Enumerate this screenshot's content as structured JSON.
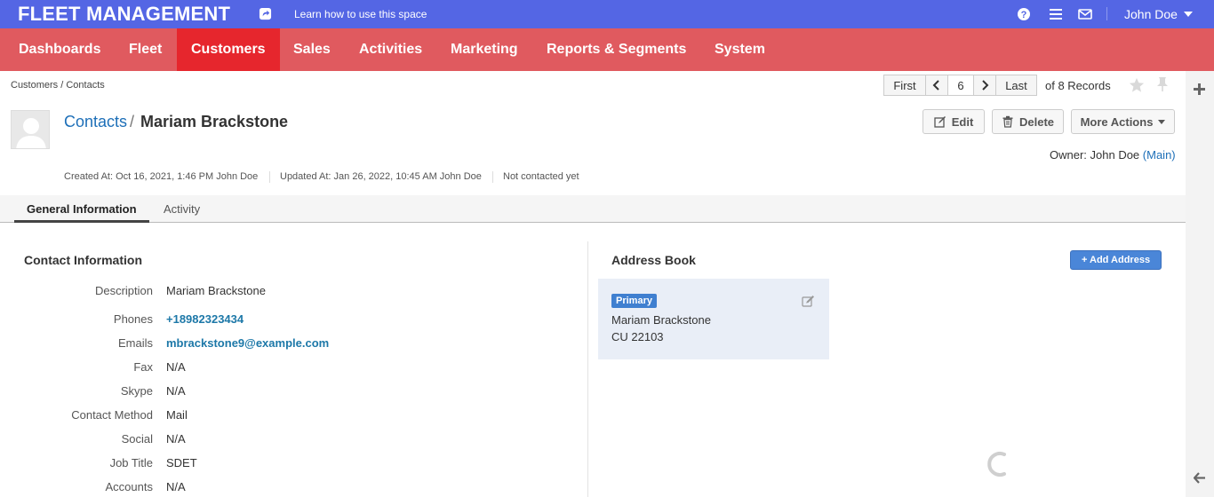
{
  "topbar": {
    "brand": "FLEET MANAGEMENT",
    "learn_link": "Learn how to use this space",
    "user_name": "John Doe"
  },
  "menu": {
    "items": [
      "Dashboards",
      "Fleet",
      "Customers",
      "Sales",
      "Activities",
      "Marketing",
      "Reports & Segments",
      "System"
    ],
    "active": "Customers"
  },
  "breadcrumb": "Customers / Contacts",
  "pager": {
    "first": "First",
    "page": "6",
    "last": "Last",
    "records": "of 8 Records"
  },
  "record": {
    "section_link": "Contacts",
    "separator": "/",
    "name": "Mariam Brackstone",
    "owner_label": "Owner: John Doe",
    "owner_scope": "(Main)",
    "created": "Created At: Oct 16, 2021, 1:46 PM John Doe",
    "updated": "Updated At: Jan 26, 2022, 10:45 AM John Doe",
    "contacted": "Not contacted yet"
  },
  "actions": {
    "edit": "Edit",
    "delete": "Delete",
    "more": "More Actions"
  },
  "tabs": [
    "General Information",
    "Activity"
  ],
  "contact_info": {
    "title": "Contact Information",
    "fields": [
      {
        "label": "Description",
        "value": "Mariam Brackstone"
      },
      {
        "label": "Phones",
        "value": "+18982323434"
      },
      {
        "label": "Emails",
        "value": "mbrackstone9@example.com"
      },
      {
        "label": "Fax",
        "value": "N/A"
      },
      {
        "label": "Skype",
        "value": "N/A"
      },
      {
        "label": "Contact Method",
        "value": "Mail"
      },
      {
        "label": "Social",
        "value": "N/A"
      },
      {
        "label": "Job Title",
        "value": "SDET"
      },
      {
        "label": "Accounts",
        "value": "N/A"
      }
    ]
  },
  "address_book": {
    "title": "Address Book",
    "add_button": "+ Add Address",
    "badge": "Primary",
    "line1": "Mariam Brackstone",
    "line2": "CU 22103"
  },
  "colors": {
    "topbar": "#5466e4",
    "menubar": "#e05a5f",
    "menu_active": "#e6262d",
    "link": "#1d6fb8",
    "primary_button": "#4a86d8"
  },
  "icons": [
    "share-icon",
    "help-icon",
    "list-icon",
    "mail-icon",
    "chevron-left-icon",
    "chevron-right-icon",
    "star-icon",
    "pin-icon",
    "plus-icon",
    "arrow-left-icon",
    "edit-icon",
    "trash-icon",
    "loading-spinner-icon"
  ]
}
